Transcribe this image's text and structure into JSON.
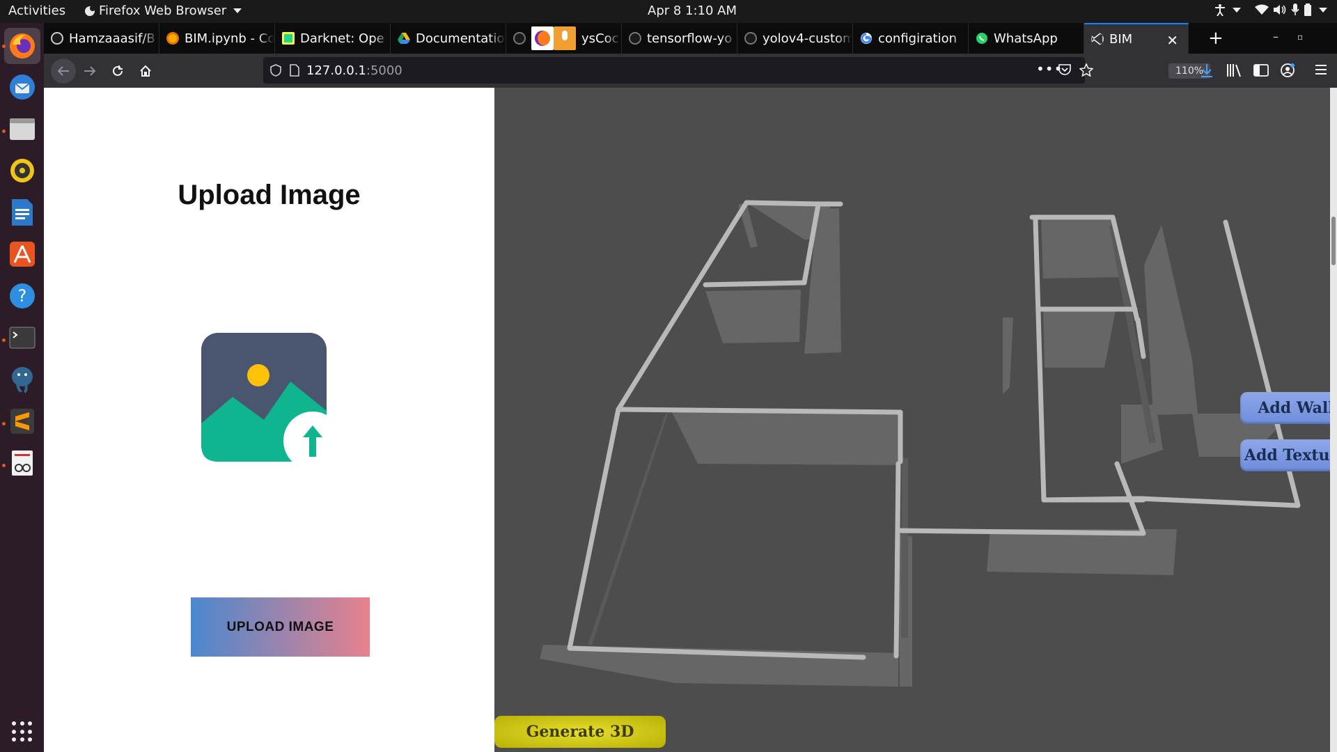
{
  "system": {
    "activities_label": "Activities",
    "app_menu_label": "Firefox Web Browser",
    "clock": "Apr 8   1:10 AM"
  },
  "dock": {
    "items": [
      "firefox-icon",
      "thunderbird-icon",
      "files-icon",
      "rhythmbox-icon",
      "writer-icon",
      "software-center-icon",
      "help-icon",
      "terminal-icon",
      "postgres-icon",
      "sublime-text-icon",
      "document-viewer-icon"
    ]
  },
  "browser": {
    "tabs": [
      {
        "label": "Hamzaaasif/B",
        "icon": "github-icon"
      },
      {
        "label": "BIM.ipynb - Co",
        "icon": "colab-icon"
      },
      {
        "label": "Darknet: Ope",
        "icon": "pycharm-icon"
      },
      {
        "label": "Documentatio",
        "icon": "drive-icon"
      },
      {
        "label": "ysCoc",
        "icon": "github-icon"
      },
      {
        "label": "tensorflow-yo",
        "icon": "github-icon"
      },
      {
        "label": "yolov4-custom",
        "icon": "github-icon"
      },
      {
        "label": "configiration",
        "icon": "google-icon"
      },
      {
        "label": "WhatsApp",
        "icon": "whatsapp-icon"
      },
      {
        "label": "BIM",
        "icon": "vscode-icon"
      }
    ],
    "url_host": "127.0.0.1",
    "url_port": ":5000",
    "zoom": "110%"
  },
  "page": {
    "title": "Upload Image",
    "upload_button": "UPLOAD IMAGE",
    "add_wall_button": "Add  Wall",
    "add_texture_button": "Add  Texture",
    "generate_button": "Generate  3D"
  },
  "colors": {
    "viewer_background": "#4d4d4d",
    "upload_gradient_start": "#4a88cf",
    "upload_gradient_end": "#e8818d",
    "side_button": "#7f9ae2",
    "generate_button": "#d6ce17",
    "illustration_frame": "#4a5670",
    "illustration_hills": "#0fb58f",
    "illustration_sun": "#ffc107"
  }
}
